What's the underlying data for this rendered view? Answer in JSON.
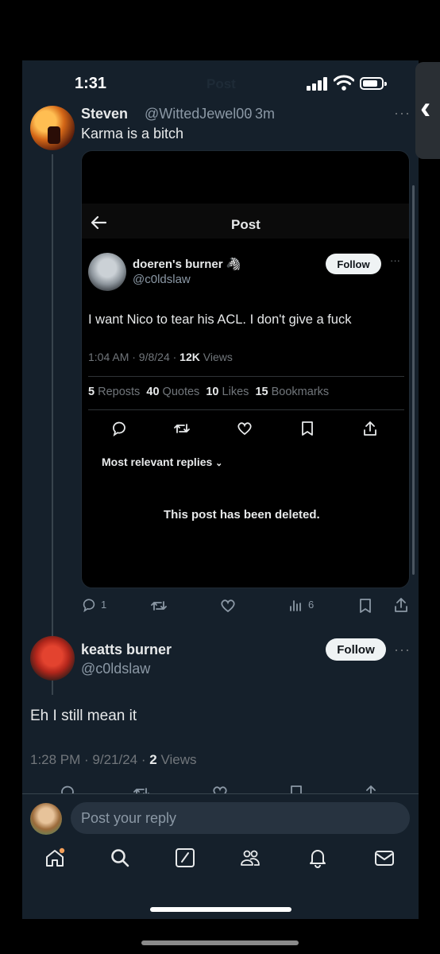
{
  "status_bar": {
    "time": "1:31",
    "faded_title": "Post"
  },
  "parent_post": {
    "name": "Steven",
    "handle": "@WittedJewel00",
    "age": "· 3m",
    "text": "Karma is a bitch",
    "more": "···",
    "actions": {
      "reply_count": "1",
      "view_count": "6"
    }
  },
  "embedded_screenshot": {
    "header_title": "Post",
    "author_name": "doeren's burner 🦓",
    "author_handle": "@c0ldslaw",
    "follow_label": "Follow",
    "more": "···",
    "text": "I want Nico to tear his ACL. I don't give a fuck",
    "meta_prefix": "1:04 AM · 9/8/24 · ",
    "meta_views_count": "12K",
    "meta_views_label": " Views",
    "stats": [
      {
        "count": "5",
        "label": "Reposts"
      },
      {
        "count": "40",
        "label": "Quotes"
      },
      {
        "count": "10",
        "label": "Likes"
      },
      {
        "count": "15",
        "label": "Bookmarks"
      }
    ],
    "replies_filter": "Most relevant replies",
    "deleted_notice": "This post has been deleted."
  },
  "reply_post": {
    "name": "keatts burner",
    "handle": "@c0ldslaw",
    "follow_label": "Follow",
    "more": "···",
    "text": "Eh I still mean it",
    "meta_prefix": "1:28 PM · 9/21/24 · ",
    "views_count": "2",
    "views_label": " Views"
  },
  "composer": {
    "placeholder": "Post your reply"
  },
  "icons": {
    "nav": [
      "home-icon",
      "search-icon",
      "compose-icon",
      "communities-icon",
      "notifications-icon",
      "messages-icon"
    ],
    "accent_dot": "#f4a05a"
  }
}
